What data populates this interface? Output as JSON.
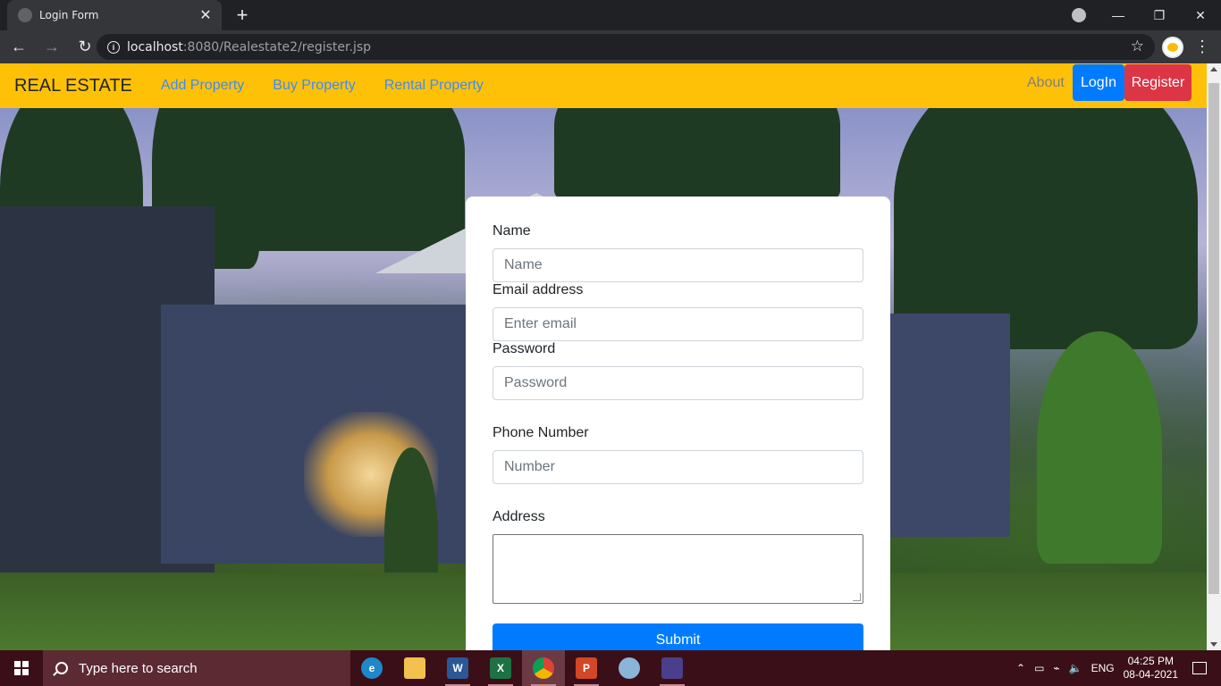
{
  "browser": {
    "tab_title": "Login Form",
    "url_host": "localhost",
    "url_path": ":8080/Realestate2/register.jsp"
  },
  "navbar": {
    "brand": "REAL ESTATE",
    "links": [
      "Add Property",
      "Buy Property",
      "Rental Property"
    ],
    "about": "About",
    "login": "LogIn",
    "register": "Register"
  },
  "form": {
    "name_label": "Name",
    "name_placeholder": "Name",
    "email_label": "Email address",
    "email_placeholder": "Enter email",
    "password_label": "Password",
    "password_placeholder": "Password",
    "phone_label": "Phone Number",
    "phone_placeholder": "Number",
    "address_label": "Address",
    "address_value": "",
    "submit_label": "Submit"
  },
  "taskbar": {
    "search_placeholder": "Type here to search",
    "language": "ENG",
    "time": "04:25 PM",
    "date": "08-04-2021",
    "apps": [
      "edge",
      "file-explorer",
      "word",
      "excel",
      "chrome",
      "powerpoint",
      "paint",
      "app"
    ]
  },
  "colors": {
    "navbar_bg": "#ffc107",
    "link": "#3d8bfd",
    "login_btn": "#007bff",
    "register_btn": "#dc3545",
    "submit_btn": "#007bff"
  }
}
